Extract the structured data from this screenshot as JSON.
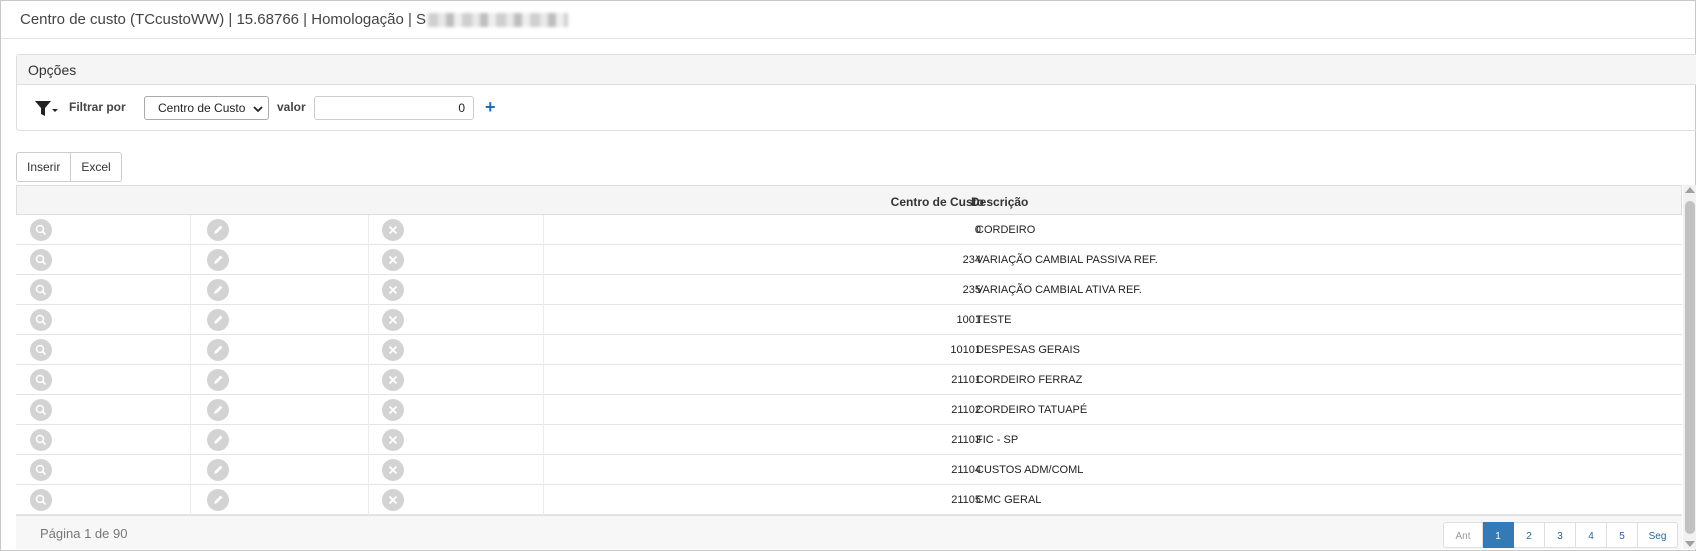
{
  "window": {
    "title": "Centro de custo (TCcustoWW) | 15.68766 | Homologação | S"
  },
  "options": {
    "header": "Opções",
    "filter_label": "Filtrar por",
    "filter_select": "Centro de Custo",
    "value_label": "valor",
    "value": "0",
    "add_symbol": "+"
  },
  "toolbar": {
    "insert_label": "Inserir",
    "excel_label": "Excel"
  },
  "grid": {
    "columns": {
      "cost_center": "Centro de Custo",
      "description": "Descrição"
    },
    "rows": [
      {
        "code": "0",
        "description": "CORDEIRO"
      },
      {
        "code": "234",
        "description": "VARIAÇÃO CAMBIAL PASSIVA REF."
      },
      {
        "code": "235",
        "description": "VARIAÇÃO CAMBIAL ATIVA REF."
      },
      {
        "code": "1001",
        "description": "TESTE"
      },
      {
        "code": "10101",
        "description": "DESPESAS GERAIS"
      },
      {
        "code": "21101",
        "description": "CORDEIRO FERRAZ"
      },
      {
        "code": "21102",
        "description": "CORDEIRO TATUAPÉ"
      },
      {
        "code": "21103",
        "description": "FIC - SP"
      },
      {
        "code": "21104",
        "description": "CUSTOS ADM/COML"
      },
      {
        "code": "21105",
        "description": "CMC GERAL"
      }
    ]
  },
  "pagination": {
    "info": "Página 1 de 90",
    "prev": "Ant",
    "pages": [
      "1",
      "2",
      "3",
      "4",
      "5"
    ],
    "next": "Seg",
    "active_page": "1"
  },
  "colors": {
    "accent": "#337ab7",
    "icon_gray": "#d3d3d3"
  }
}
